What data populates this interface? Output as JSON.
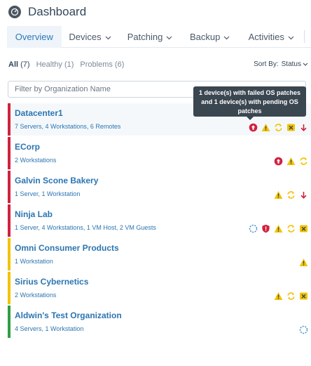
{
  "header": {
    "title": "Dashboard",
    "logo_icon": "gauge-icon"
  },
  "tabs": [
    {
      "label": "Overview",
      "active": true
    },
    {
      "label": "Devices"
    },
    {
      "label": "Patching"
    },
    {
      "label": "Backup"
    },
    {
      "label": "Activities"
    }
  ],
  "filters": {
    "all": {
      "label": "All",
      "count": "(7)"
    },
    "healthy": {
      "label": "Healthy",
      "count": "(1)"
    },
    "problems": {
      "label": "Problems",
      "count": "(6)"
    }
  },
  "sort": {
    "label": "Sort By:",
    "value": "Status"
  },
  "search": {
    "placeholder": "Filter by Organization Name",
    "value": ""
  },
  "tooltip": {
    "line1": "1 device(s) with failed OS patches",
    "line2": "and 1 device(s) with pending OS",
    "line3": "patches"
  },
  "colors": {
    "critical": "#d0223f",
    "warning": "#f2c300",
    "healthy": "#2f9e44",
    "link": "#2c75b1"
  },
  "organizations": [
    {
      "name": "Datacenter1",
      "summary": "7 Servers, 4 Workstations, 6 Remotes",
      "status": "critical",
      "icons": [
        "failed-patch-icon",
        "warning-icon",
        "pending-sync-icon",
        "backup-failed-icon",
        "arrow-down-icon"
      ]
    },
    {
      "name": "ECorp",
      "summary": "2 Workstations",
      "status": "critical",
      "icons": [
        "failed-patch-icon",
        "warning-icon",
        "pending-sync-icon"
      ]
    },
    {
      "name": "Galvin Scone Bakery",
      "summary": "1 Server, 1 Workstation",
      "status": "critical",
      "icons": [
        "warning-icon",
        "pending-sync-icon",
        "arrow-down-icon"
      ]
    },
    {
      "name": "Ninja Lab",
      "summary": "1 Server, 4 Workstations, 1 VM Host, 2 VM Guests",
      "status": "critical",
      "icons": [
        "loading-spinner-icon",
        "shield-alert-icon",
        "warning-icon",
        "pending-sync-icon",
        "backup-failed-icon"
      ]
    },
    {
      "name": "Omni Consumer Products",
      "summary": "1 Workstation",
      "status": "warning",
      "icons": [
        "warning-icon"
      ]
    },
    {
      "name": "Sirius Cybernetics",
      "summary": "2 Workstations",
      "status": "warning",
      "icons": [
        "warning-icon",
        "pending-sync-icon",
        "backup-failed-icon"
      ]
    },
    {
      "name": "Aldwin's Test Organization",
      "summary": "4 Servers, 1 Workstation",
      "status": "healthy",
      "icons": [
        "loading-spinner-icon"
      ]
    }
  ]
}
